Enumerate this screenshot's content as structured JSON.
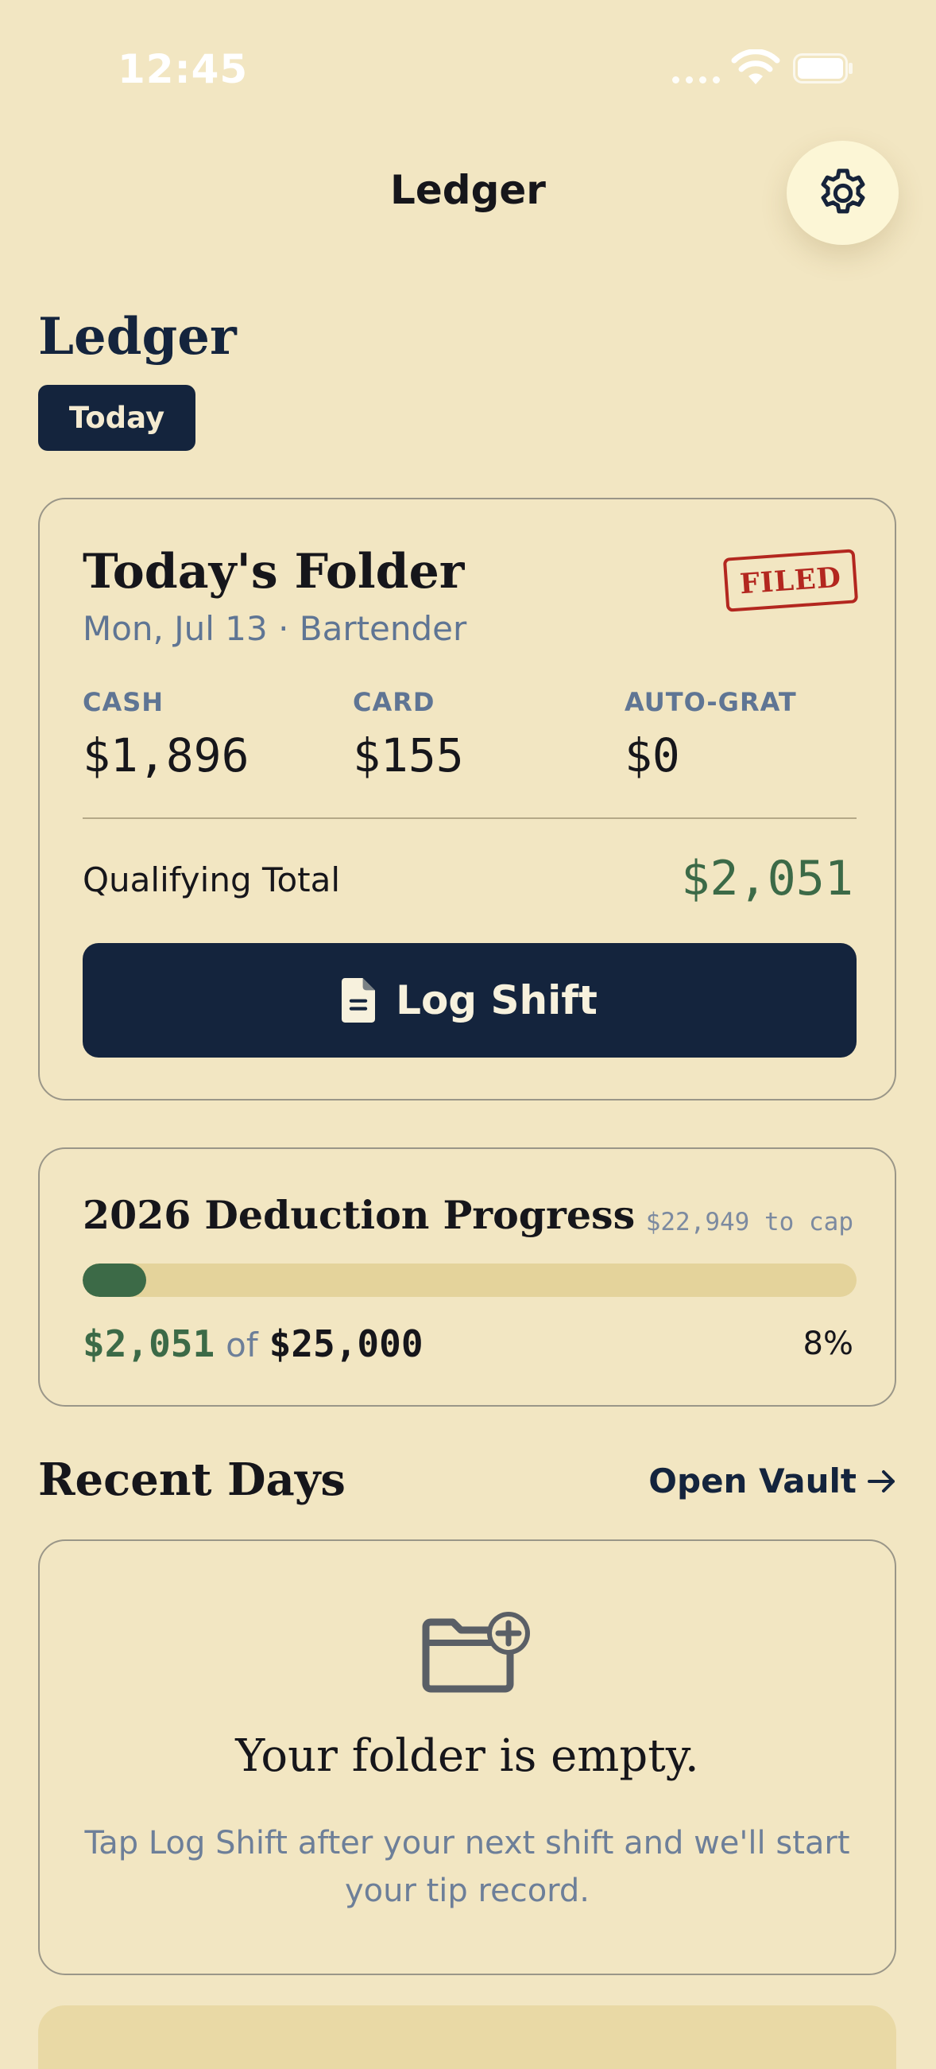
{
  "status_bar": {
    "time": "12:45"
  },
  "nav": {
    "title": "Ledger",
    "settings_icon": "gear-icon"
  },
  "header": {
    "title": "Ledger",
    "chip": "Today"
  },
  "today_folder": {
    "title": "Today's Folder",
    "subtitle": "Mon, Jul 13 · Bartender",
    "stamp": "FILED",
    "metrics": [
      {
        "label": "CASH",
        "value": "$1,896"
      },
      {
        "label": "CARD",
        "value": "$155"
      },
      {
        "label": "AUTO-GRAT",
        "value": "$0"
      }
    ],
    "qualifying_label": "Qualifying Total",
    "qualifying_value": "$2,051",
    "log_button": "Log Shift",
    "log_icon": "document-icon"
  },
  "deduction": {
    "title": "2026 Deduction Progress",
    "to_cap": "$22,949 to cap",
    "amount": "$2,051",
    "of": "of",
    "cap": "$25,000",
    "percent_label": "8%",
    "progress_fraction": 0.082,
    "fill_color": "#3c6a47"
  },
  "recent": {
    "title": "Recent Days",
    "open_vault": "Open Vault",
    "empty_title": "Your folder is empty.",
    "empty_desc": "Tap Log Shift after your next shift and we'll start your tip record.",
    "empty_icon": "folder-plus-icon"
  },
  "colors": {
    "background": "#f2e6c2",
    "navy": "#14243d",
    "green": "#3c6a47",
    "stamp_red": "#b3271f"
  }
}
